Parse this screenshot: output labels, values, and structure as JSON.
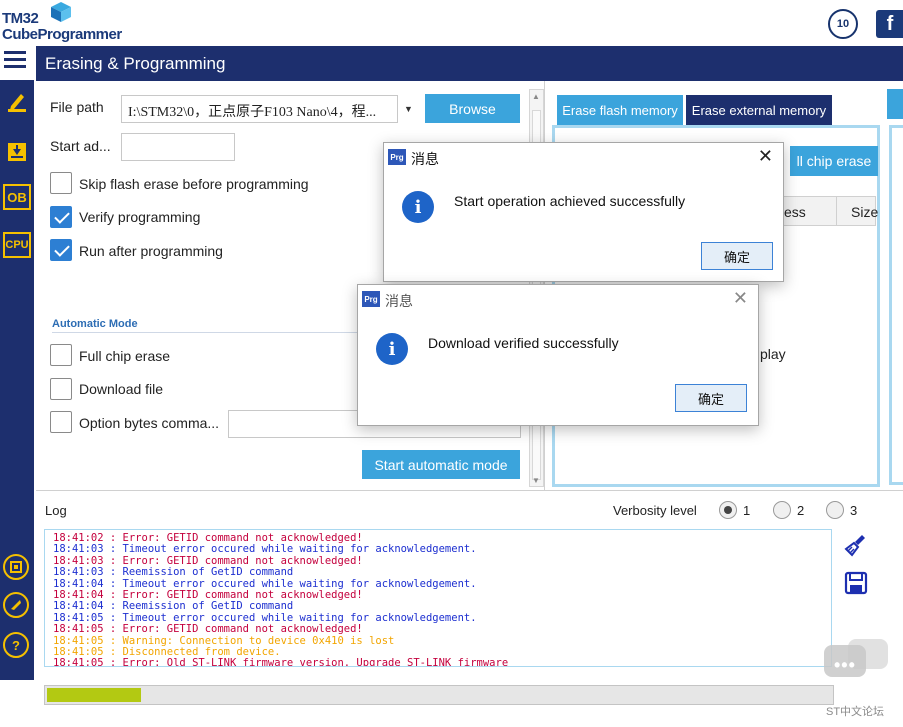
{
  "brand": {
    "logo_line1": "TM32",
    "logo_line2": "CubeProgrammer",
    "anniversary_badge": "10",
    "facebook": "f"
  },
  "header": {
    "title": "Erasing & Programming"
  },
  "nav": {
    "ob_label": "OB",
    "cpu_label": "CPU",
    "help_label": "?"
  },
  "program": {
    "file_path_label": "File path",
    "file_path_value": "I:\\STM32\\0，正点原子F103 Nano\\4，程...",
    "browse_label": "Browse",
    "start_address_label": "Start ad...",
    "start_address_value": "",
    "skip_erase_label": "Skip flash erase before programming",
    "skip_erase_checked": false,
    "verify_label": "Verify programming",
    "verify_checked": true,
    "run_after_label": "Run after programming",
    "run_after_checked": true,
    "automatic_mode_label": "Automatic Mode",
    "full_chip_erase_label": "Full chip erase",
    "download_file_label": "Download file",
    "option_bytes_label": "Option bytes comma...",
    "option_bytes_value": "",
    "start_auto_label": "Start automatic mode"
  },
  "erase": {
    "tab_flash": "Erase flash memory",
    "tab_external": "Erase external memory",
    "full_chip_erase_button": "ll chip erase",
    "col_address": "ess",
    "col_size": "Size",
    "bottom_text": "play"
  },
  "log": {
    "title": "Log",
    "verbosity_label": "Verbosity level",
    "verbosity_options": [
      "1",
      "2",
      "3"
    ],
    "verbosity_selected": "1",
    "lines": [
      {
        "text": "18:41:02 : Error: GETID command not acknowledged!",
        "level": "error"
      },
      {
        "text": "18:41:03 : Timeout error occured while waiting for acknowledgement.",
        "level": "info"
      },
      {
        "text": "18:41:03 : Error: GETID command not acknowledged!",
        "level": "error"
      },
      {
        "text": "18:41:03 : Reemission of GetID command",
        "level": "info"
      },
      {
        "text": "18:41:04 : Timeout error occured while waiting for acknowledgement.",
        "level": "info"
      },
      {
        "text": "18:41:04 : Error: GETID command not acknowledged!",
        "level": "error"
      },
      {
        "text": "18:41:04 : Reemission of GetID command",
        "level": "info"
      },
      {
        "text": "18:41:05 : Timeout error occured while waiting for acknowledgement.",
        "level": "info"
      },
      {
        "text": "18:41:05 : Error: GETID command not acknowledged!",
        "level": "error"
      },
      {
        "text": "18:41:05 : Warning: Connection to device 0x410 is lost",
        "level": "warn"
      },
      {
        "text": "18:41:05 : Disconnected from device.",
        "level": "warn"
      },
      {
        "text": "18:41:05 : Error: Old ST-LINK firmware version. Upgrade ST-LINK firmware",
        "level": "error"
      }
    ],
    "progress_fraction": 0.12
  },
  "dialogs": {
    "first": {
      "icon_label": "Prg",
      "title": "消息",
      "message": "Start operation achieved successfully",
      "ok_label": "确定"
    },
    "second": {
      "icon_label": "Prg",
      "title": "消息",
      "message": "Download verified successfully",
      "ok_label": "确定"
    }
  },
  "watermark": {
    "text": "ST中文论坛"
  },
  "colors": {
    "navy": "#1d2f6e",
    "accent_blue": "#3ba4dc",
    "nav_icon_yellow": "#f5c000",
    "progress_green": "#b3c912"
  }
}
